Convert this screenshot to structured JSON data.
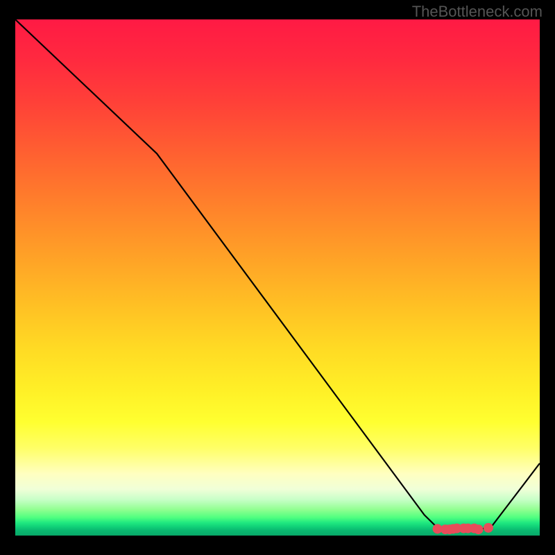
{
  "watermark": "TheBottleneck.com",
  "chart_data": {
    "type": "line",
    "title": "",
    "xlabel": "",
    "ylabel": "",
    "xlim": [
      0,
      100
    ],
    "ylim": [
      0,
      100
    ],
    "x": [
      0,
      27,
      78,
      80,
      81.5,
      83,
      84,
      85.5,
      87,
      88.5,
      90,
      91,
      100
    ],
    "values": [
      100,
      74,
      4,
      2,
      1.2,
      1.2,
      1.4,
      1.4,
      1.4,
      1.2,
      1.5,
      2,
      14
    ],
    "markers": {
      "x": [
        80.5,
        82,
        82.8,
        83.5,
        84.2,
        85.5,
        86.3,
        87.5,
        88.3,
        90.2
      ],
      "y": [
        1.3,
        1.2,
        1.2,
        1.3,
        1.4,
        1.4,
        1.4,
        1.4,
        1.2,
        1.5
      ],
      "color": "#e84c5a",
      "size": 7
    },
    "line_color": "#000000",
    "line_width": 2.2
  }
}
